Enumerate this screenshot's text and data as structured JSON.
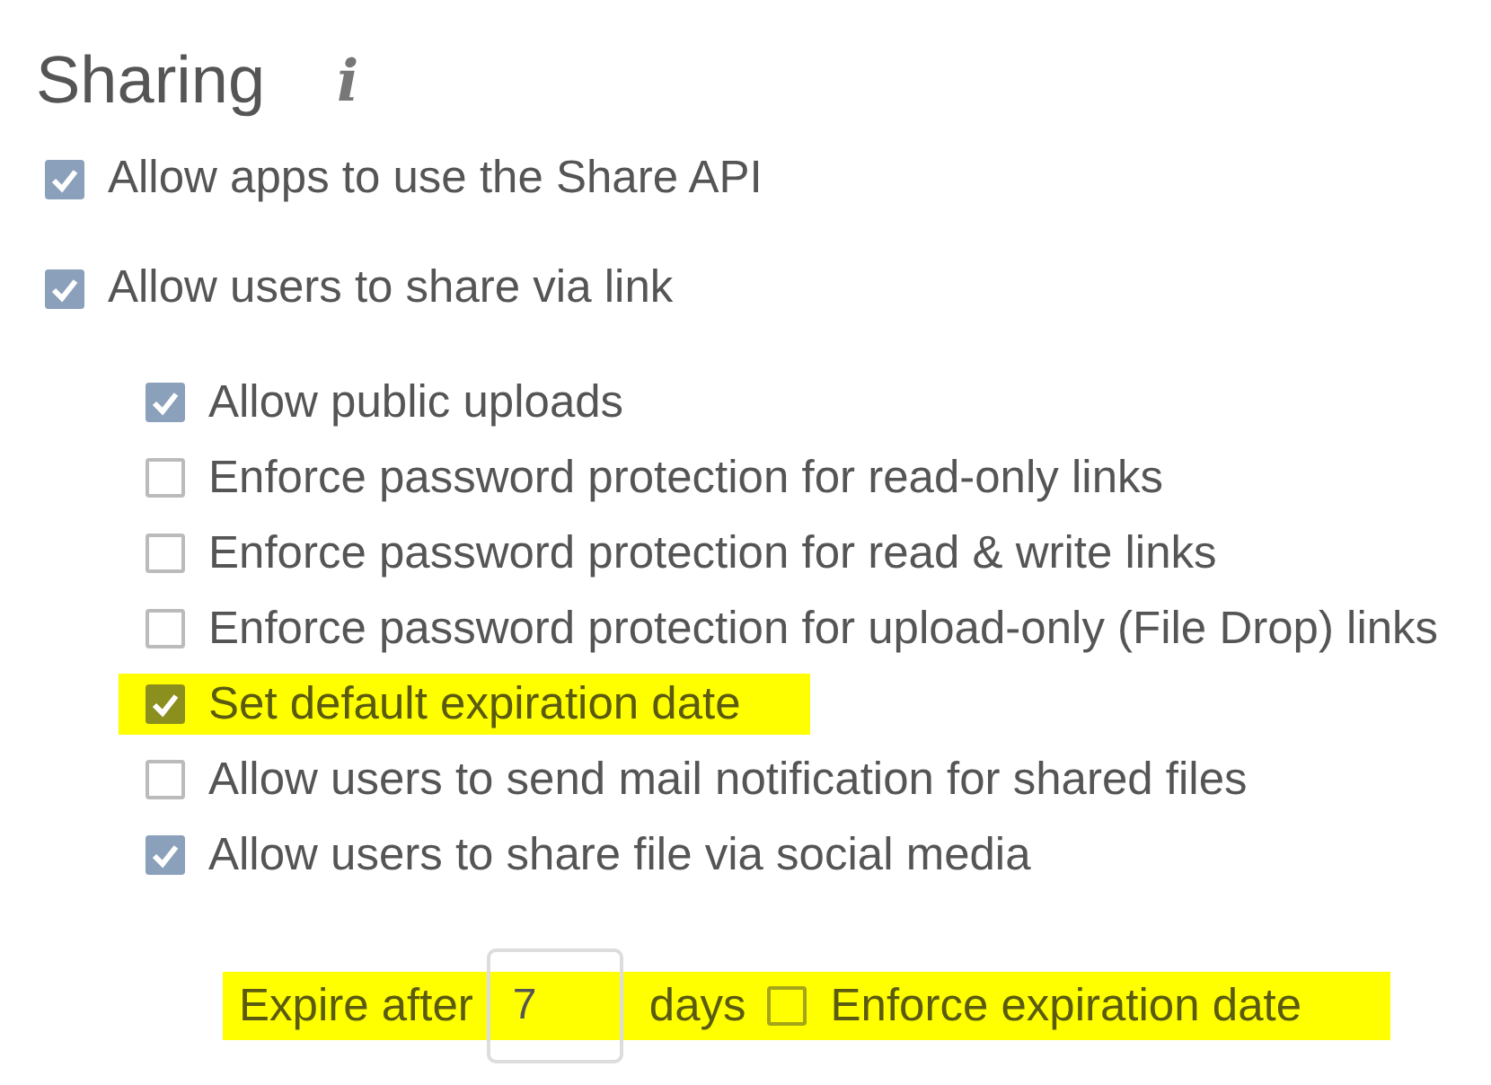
{
  "title": "Sharing",
  "info_symbol": "i",
  "options": [
    {
      "label": "Allow apps to use the Share API",
      "checked": true,
      "highlighted": false
    },
    {
      "label": "Allow users to share via link",
      "checked": true,
      "highlighted": false,
      "children": [
        {
          "label": "Allow public uploads",
          "checked": true,
          "highlighted": false
        },
        {
          "label": "Enforce password protection for read-only links",
          "checked": false,
          "highlighted": false
        },
        {
          "label": "Enforce password protection for read & write links",
          "checked": false,
          "highlighted": false
        },
        {
          "label": "Enforce password protection for upload-only (File Drop) links",
          "checked": false,
          "highlighted": false
        },
        {
          "label": "Set default expiration date",
          "checked": true,
          "highlighted": true
        },
        {
          "label": "Allow users to send mail notification for shared files",
          "checked": false,
          "highlighted": false
        },
        {
          "label": "Allow users to share file via social media",
          "checked": true,
          "highlighted": false
        }
      ]
    }
  ],
  "expiry": {
    "label_before": "Expire after",
    "value": "7",
    "label_after": "days",
    "highlighted": true,
    "enforce": {
      "label": "Enforce expiration date",
      "checked": false
    }
  }
}
